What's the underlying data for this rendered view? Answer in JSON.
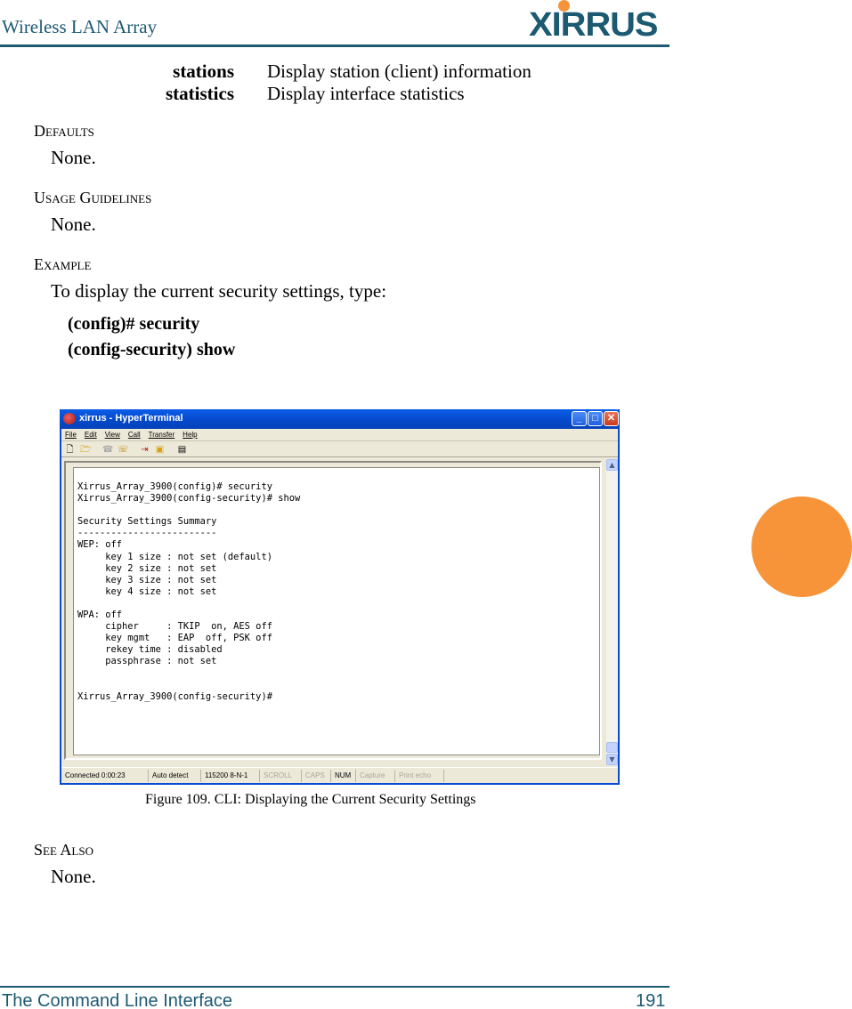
{
  "header": {
    "title": "Wireless LAN Array",
    "logo_text": "XIRRUS",
    "brand_color": "#1c5a72",
    "accent_color": "#f7943a"
  },
  "params": [
    {
      "name": "stations",
      "desc": "Display station (client) information"
    },
    {
      "name": "statistics",
      "desc": "Display interface statistics"
    }
  ],
  "sections": {
    "defaults": {
      "heading": "Defaults",
      "text": "None."
    },
    "usage": {
      "heading": "Usage Guidelines",
      "text": "None."
    },
    "example": {
      "heading": "Example",
      "text": "To display the current security settings, type:"
    },
    "see_also": {
      "heading": "See Also",
      "text": "None."
    }
  },
  "commands": [
    "(config)# security",
    "(config-security) show"
  ],
  "window": {
    "title": "xirrus - HyperTerminal",
    "menu": [
      "File",
      "Edit",
      "View",
      "Call",
      "Transfer",
      "Help"
    ],
    "toolbar_icons": [
      "new-icon",
      "open-icon",
      "disconnect-icon",
      "connect-icon",
      "send-icon",
      "receive-icon",
      "properties-icon"
    ],
    "terminal_text": "Xirrus_Array_3900(config)# security\nXirrus_Array_3900(config-security)# show\n\nSecurity Settings Summary\n-------------------------\nWEP: off\n     key 1 size : not set (default)\n     key 2 size : not set\n     key 3 size : not set\n     key 4 size : not set\n\nWPA: off\n     cipher     : TKIP  on, AES off\n     key mgmt   : EAP  off, PSK off\n     rekey time : disabled\n     passphrase : not set\n\n\nXirrus_Array_3900(config-security)#",
    "status": [
      {
        "label": "Connected 0:00:23",
        "dim": false
      },
      {
        "label": "Auto detect",
        "dim": false
      },
      {
        "label": "115200 8-N-1",
        "dim": false
      },
      {
        "label": "SCROLL",
        "dim": true
      },
      {
        "label": "CAPS",
        "dim": true
      },
      {
        "label": "NUM",
        "dim": false
      },
      {
        "label": "Capture",
        "dim": true
      },
      {
        "label": "Print echo",
        "dim": true
      }
    ]
  },
  "caption": "Figure 109. CLI: Displaying the Current Security Settings",
  "footer": {
    "chapter": "The Command Line Interface",
    "page": "191"
  }
}
